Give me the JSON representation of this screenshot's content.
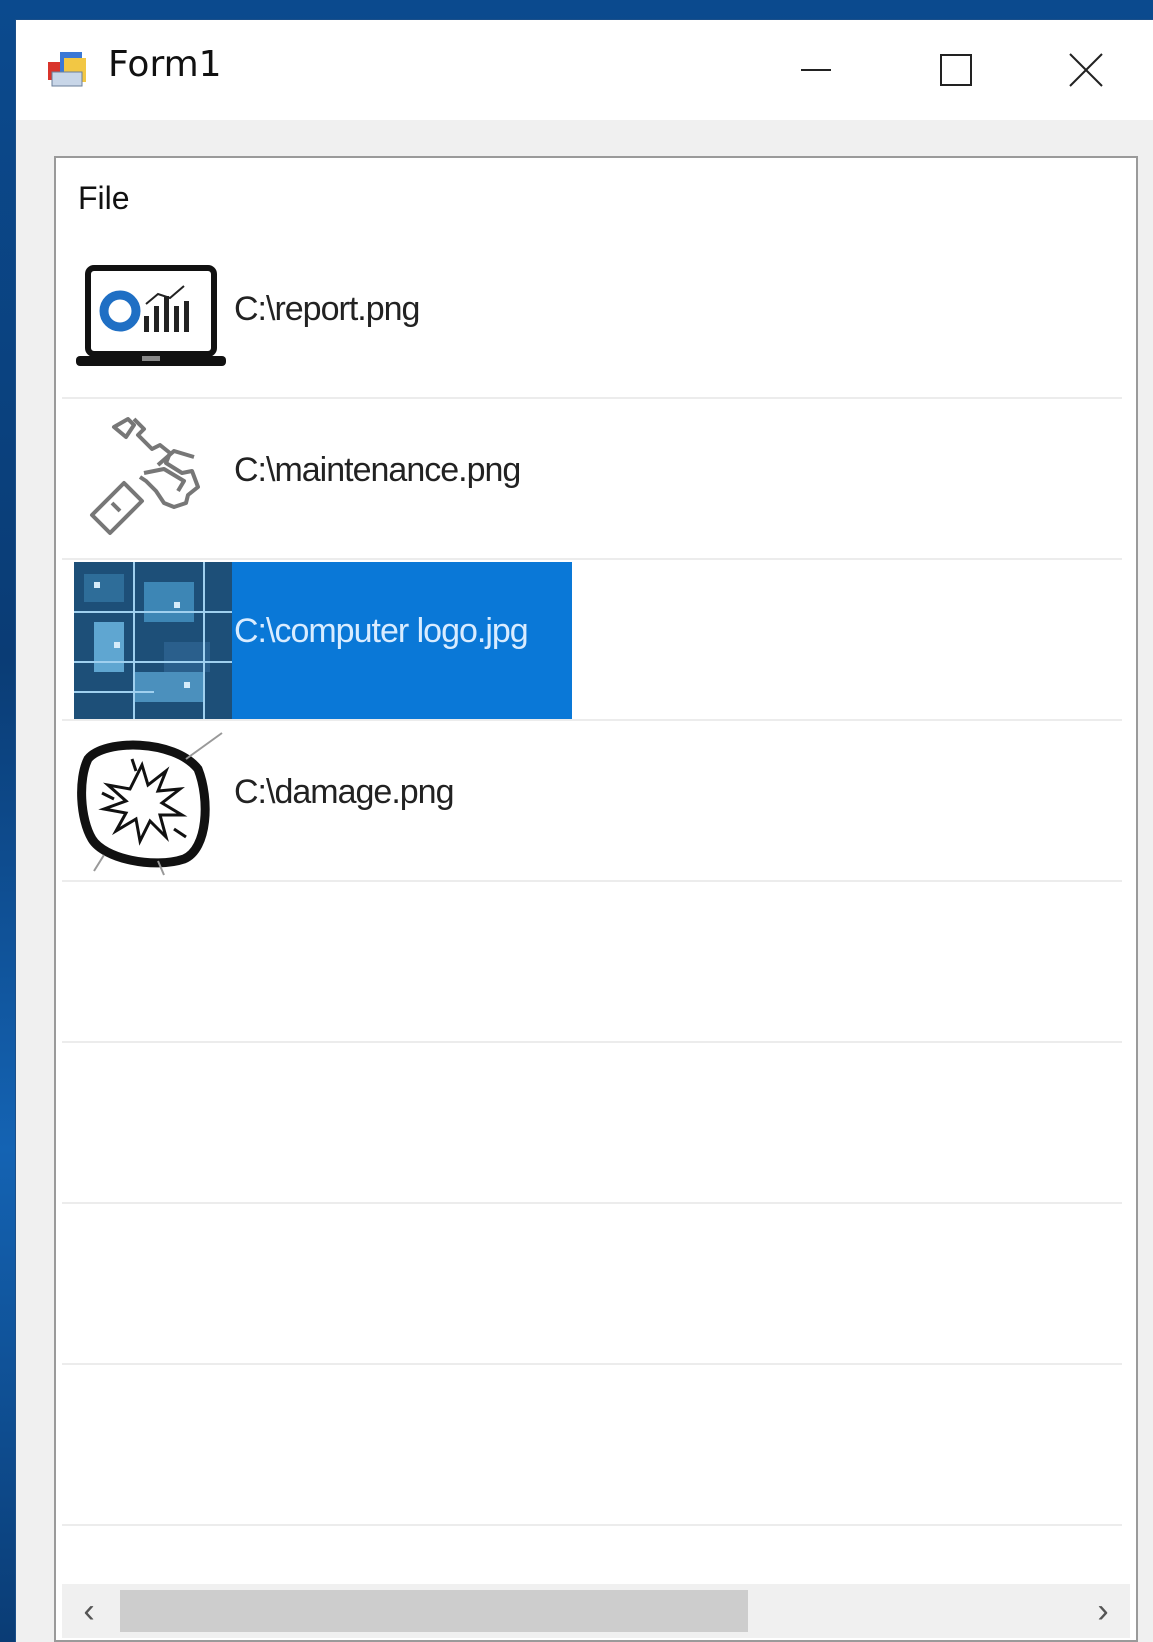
{
  "window": {
    "title": "Form1",
    "minimize_icon": "minimize-icon",
    "maximize_icon": "maximize-icon",
    "close_icon": "close-icon"
  },
  "listview": {
    "header": "File",
    "items": [
      {
        "label": "C:\\report.png",
        "icon": "laptop-chart-icon",
        "selected": false
      },
      {
        "label": "C:\\maintenance.png",
        "icon": "wrench-hand-icon",
        "selected": false
      },
      {
        "label": "C:\\computer logo.jpg",
        "icon": "circuit-board-thumbnail",
        "selected": true
      },
      {
        "label": "C:\\damage.png",
        "icon": "broken-tv-icon",
        "selected": false
      },
      {
        "label": "",
        "icon": "",
        "selected": false
      },
      {
        "label": "",
        "icon": "",
        "selected": false
      },
      {
        "label": "",
        "icon": "",
        "selected": false
      },
      {
        "label": "",
        "icon": "",
        "selected": false
      }
    ],
    "scrollbar": {
      "left_arrow": "‹",
      "right_arrow": "›"
    }
  },
  "colors": {
    "selection": "#0a78d7",
    "desktop": "#0b4a8e"
  }
}
